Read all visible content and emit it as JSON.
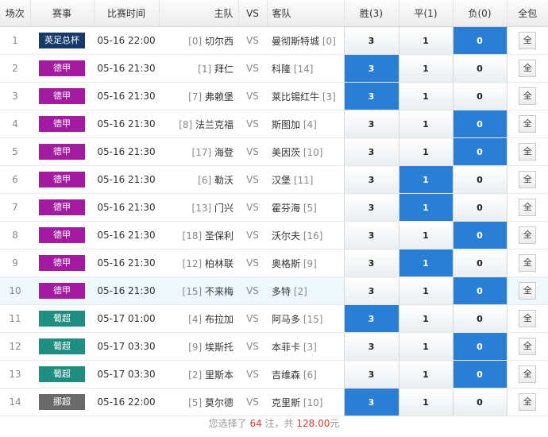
{
  "headers": {
    "index": "场次",
    "league": "赛事",
    "time": "比赛时间",
    "home": "主队",
    "vs": "VS",
    "away": "客队",
    "win": "胜(3)",
    "draw": "平(1)",
    "loss": "负(0)",
    "all": "全包"
  },
  "colors": {
    "yingzu": "#173a6b",
    "dejia": "#a21ba0",
    "puchao": "#1f8e80",
    "nuochao": "#6a6a6a",
    "selected": "#2a7fd4",
    "highlight_row": "#eef8fd",
    "footer_number": "#e03a2f"
  },
  "matches": [
    {
      "index": "1",
      "league": "英足总杯",
      "league_color": "#173a6b",
      "time": "05-16 22:00",
      "home_rank": "[0]",
      "home": "切尔西",
      "vs": "VS",
      "away": "曼彻斯特城",
      "away_rank": "[0]",
      "win": "3",
      "draw": "1",
      "loss": "0",
      "selected": "loss",
      "all": "全"
    },
    {
      "index": "2",
      "league": "德甲",
      "league_color": "#a21ba0",
      "time": "05-16 21:30",
      "home_rank": "[1]",
      "home": "拜仁",
      "vs": "VS",
      "away": "科隆",
      "away_rank": "[14]",
      "win": "3",
      "draw": "1",
      "loss": "0",
      "selected": "win",
      "all": "全"
    },
    {
      "index": "3",
      "league": "德甲",
      "league_color": "#a21ba0",
      "time": "05-16 21:30",
      "home_rank": "[7]",
      "home": "弗赖堡",
      "vs": "VS",
      "away": "莱比锡红牛",
      "away_rank": "[3]",
      "win": "3",
      "draw": "1",
      "loss": "0",
      "selected": "win",
      "all": "全"
    },
    {
      "index": "4",
      "league": "德甲",
      "league_color": "#a21ba0",
      "time": "05-16 21:30",
      "home_rank": "[8]",
      "home": "法兰克福",
      "vs": "VS",
      "away": "斯图加",
      "away_rank": "[4]",
      "win": "3",
      "draw": "1",
      "loss": "0",
      "selected": "loss",
      "all": "全"
    },
    {
      "index": "5",
      "league": "德甲",
      "league_color": "#a21ba0",
      "time": "05-16 21:30",
      "home_rank": "[17]",
      "home": "海登",
      "vs": "VS",
      "away": "美因茨",
      "away_rank": "[10]",
      "win": "3",
      "draw": "1",
      "loss": "0",
      "selected": "loss",
      "all": "全"
    },
    {
      "index": "6",
      "league": "德甲",
      "league_color": "#a21ba0",
      "time": "05-16 21:30",
      "home_rank": "[6]",
      "home": "勒沃",
      "vs": "VS",
      "away": "汉堡",
      "away_rank": "[11]",
      "win": "3",
      "draw": "1",
      "loss": "0",
      "selected": "draw",
      "all": "全"
    },
    {
      "index": "7",
      "league": "德甲",
      "league_color": "#a21ba0",
      "time": "05-16 21:30",
      "home_rank": "[13]",
      "home": "门兴",
      "vs": "VS",
      "away": "霍芬海",
      "away_rank": "[5]",
      "win": "3",
      "draw": "1",
      "loss": "0",
      "selected": "draw",
      "all": "全"
    },
    {
      "index": "8",
      "league": "德甲",
      "league_color": "#a21ba0",
      "time": "05-16 21:30",
      "home_rank": "[18]",
      "home": "圣保利",
      "vs": "VS",
      "away": "沃尔夫",
      "away_rank": "[16]",
      "win": "3",
      "draw": "1",
      "loss": "0",
      "selected": "loss",
      "all": "全"
    },
    {
      "index": "9",
      "league": "德甲",
      "league_color": "#a21ba0",
      "time": "05-16 21:30",
      "home_rank": "[12]",
      "home": "柏林联",
      "vs": "VS",
      "away": "奥格斯",
      "away_rank": "[9]",
      "win": "3",
      "draw": "1",
      "loss": "0",
      "selected": "draw",
      "all": "全"
    },
    {
      "index": "10",
      "league": "德甲",
      "league_color": "#a21ba0",
      "time": "05-16 21:30",
      "home_rank": "[15]",
      "home": "不来梅",
      "vs": "VS",
      "away": "多特",
      "away_rank": "[2]",
      "win": "3",
      "draw": "1",
      "loss": "0",
      "selected": "loss",
      "all": "全"
    },
    {
      "index": "11",
      "league": "葡超",
      "league_color": "#1f8e80",
      "time": "05-17 01:00",
      "home_rank": "[4]",
      "home": "布拉加",
      "vs": "VS",
      "away": "阿马多",
      "away_rank": "[15]",
      "win": "3",
      "draw": "1",
      "loss": "0",
      "selected": "win",
      "all": "全"
    },
    {
      "index": "12",
      "league": "葡超",
      "league_color": "#1f8e80",
      "time": "05-17 03:30",
      "home_rank": "[9]",
      "home": "埃斯托",
      "vs": "VS",
      "away": "本菲卡",
      "away_rank": "[3]",
      "win": "3",
      "draw": "1",
      "loss": "0",
      "selected": "loss",
      "all": "全"
    },
    {
      "index": "13",
      "league": "葡超",
      "league_color": "#1f8e80",
      "time": "05-17 03:30",
      "home_rank": "[2]",
      "home": "里斯本",
      "vs": "VS",
      "away": "吉维森",
      "away_rank": "[6]",
      "win": "3",
      "draw": "1",
      "loss": "0",
      "selected": "loss",
      "all": "全"
    },
    {
      "index": "14",
      "league": "挪超",
      "league_color": "#6a6a6a",
      "time": "05-16 22:00",
      "home_rank": "[5]",
      "home": "莫尔德",
      "vs": "VS",
      "away": "克里斯",
      "away_rank": "[10]",
      "win": "3",
      "draw": "1",
      "loss": "0",
      "selected": "win",
      "all": "全"
    }
  ],
  "highlighted_row": "10",
  "footer": {
    "prefix": "您选择了",
    "count": "64",
    "middle": "注，共",
    "amount": "128.00",
    "suffix": "元"
  }
}
